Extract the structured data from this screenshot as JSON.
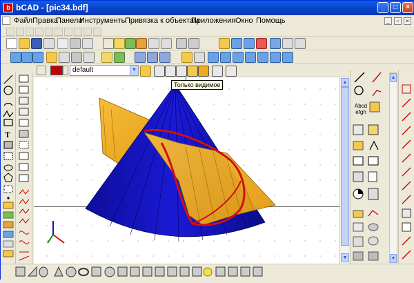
{
  "window": {
    "title": "bCAD - [pic34.bdf]",
    "app_icon_glyph": "b",
    "controls": {
      "minimize": "_",
      "maximize": "□",
      "close": "×"
    }
  },
  "menu": {
    "items": [
      "Файл",
      "Правка",
      "Панели",
      "Инструменты",
      "Привязка к объектам",
      "Приложения",
      "Окно",
      "Помощь"
    ],
    "mdi_controls": {
      "minimize": "_",
      "restore": "▫",
      "close": "×"
    }
  },
  "properties_bar": {
    "layer_value": "default",
    "color_hex": "#c0000a"
  },
  "tooltip": {
    "text": "Только видимое"
  },
  "right_panel": {
    "text_tool_label": "Abcd efgh"
  },
  "icons": {
    "toolbar_row2": [
      "new-icon",
      "open-icon",
      "save-icon",
      "print-icon",
      "preview-icon",
      "cut-icon",
      "copy-icon",
      "paste-icon",
      "select-icon",
      "move-icon",
      "rotate-icon",
      "scale-icon",
      "mirror-icon",
      "erase-icon",
      "undo-icon",
      "redo-icon",
      "pan-icon",
      "zoom-in-icon",
      "zoom-out-icon",
      "zoom-window-icon",
      "zoom-all-icon",
      "stop-icon",
      "settings-icon",
      "help-icon"
    ],
    "render_modes": [
      "wireframe-icon",
      "hidden-line-icon",
      "shaded-icon",
      "visible-only-icon",
      "flat-icon",
      "box-icon",
      "view-icon"
    ],
    "left_tools": [
      "line-icon",
      "circle-icon",
      "arc-icon",
      "polyline-icon",
      "rectangle-icon",
      "text-icon",
      "hatch-icon",
      "block-icon",
      "ellipse-icon",
      "polygon-icon",
      "point-icon",
      "dimension-icon"
    ],
    "colors": {
      "cone": "#1515b8",
      "surface": "#f2ab18",
      "intersection": "#d01010",
      "accent": "#0a3fc8"
    }
  }
}
